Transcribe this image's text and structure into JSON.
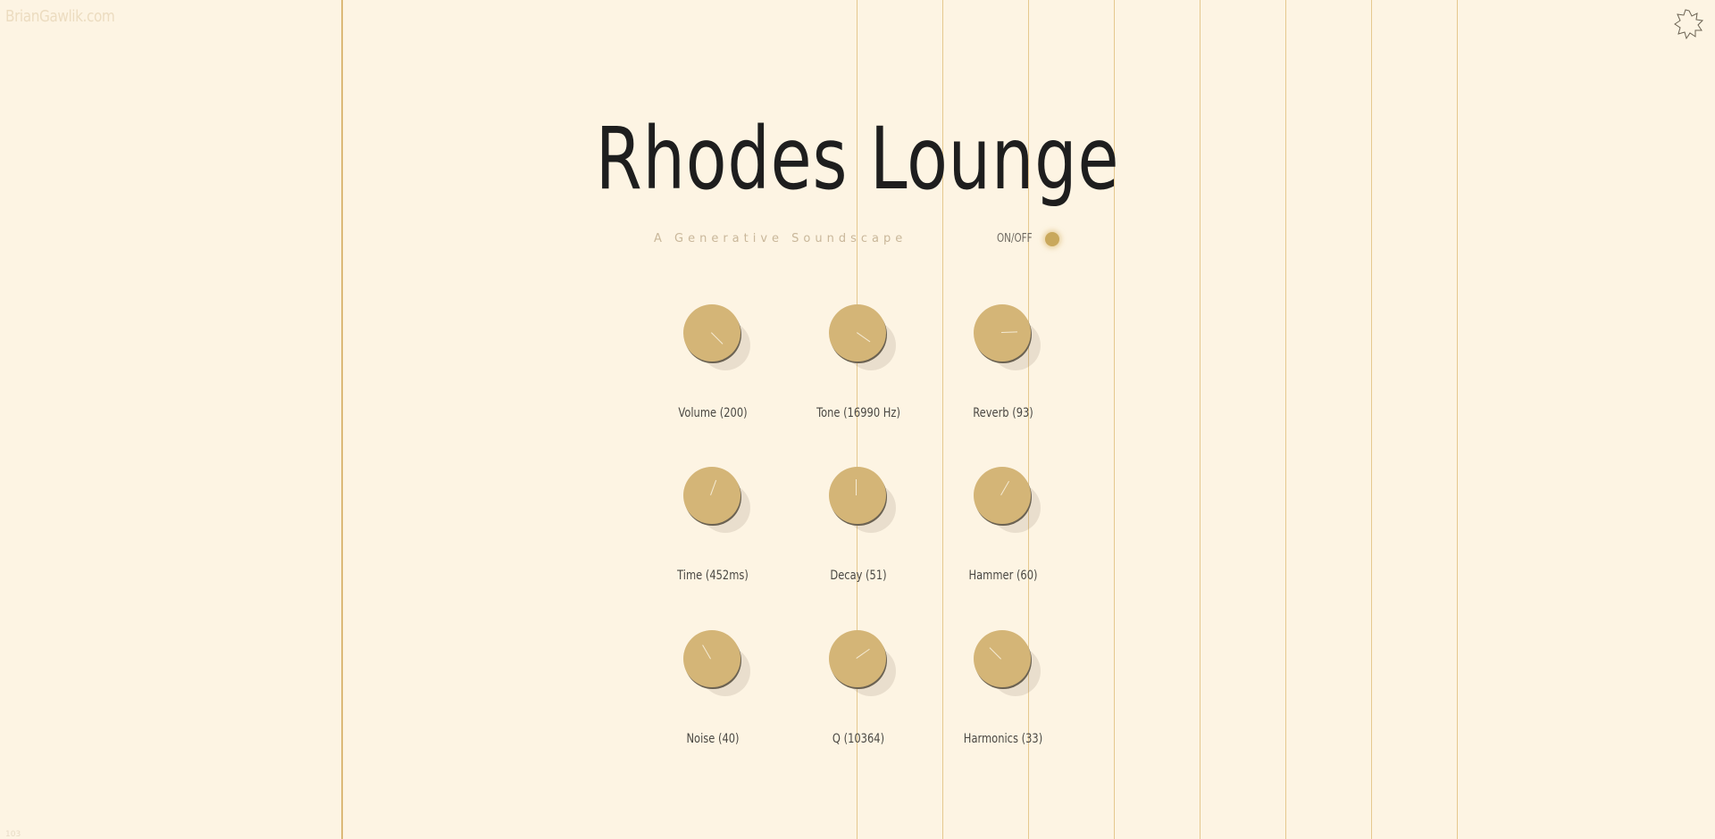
{
  "site": {
    "name": "BrianGawlik.com"
  },
  "corner_note": "103",
  "header": {
    "title": "Rhodes Lounge",
    "subtitle": "A Generative Soundscape",
    "onoff_label": "ON/OFF"
  },
  "icons": {
    "settings": "settings-burst-icon"
  },
  "colors": {
    "background": "#fdf4e3",
    "knob": "#d4b577",
    "string": "#e5c88e",
    "power_led": "#c9a85c"
  },
  "knobs": [
    {
      "label": "Volume (200)"
    },
    {
      "label": "Tone (16990 Hz)"
    },
    {
      "label": "Reverb (93)"
    },
    {
      "label": "Time (452ms)"
    },
    {
      "label": "Decay (51)"
    },
    {
      "label": "Hammer (60)"
    },
    {
      "label": "Noise (40)"
    },
    {
      "label": "Q (10364)"
    },
    {
      "label": "Harmonics (33)"
    }
  ]
}
